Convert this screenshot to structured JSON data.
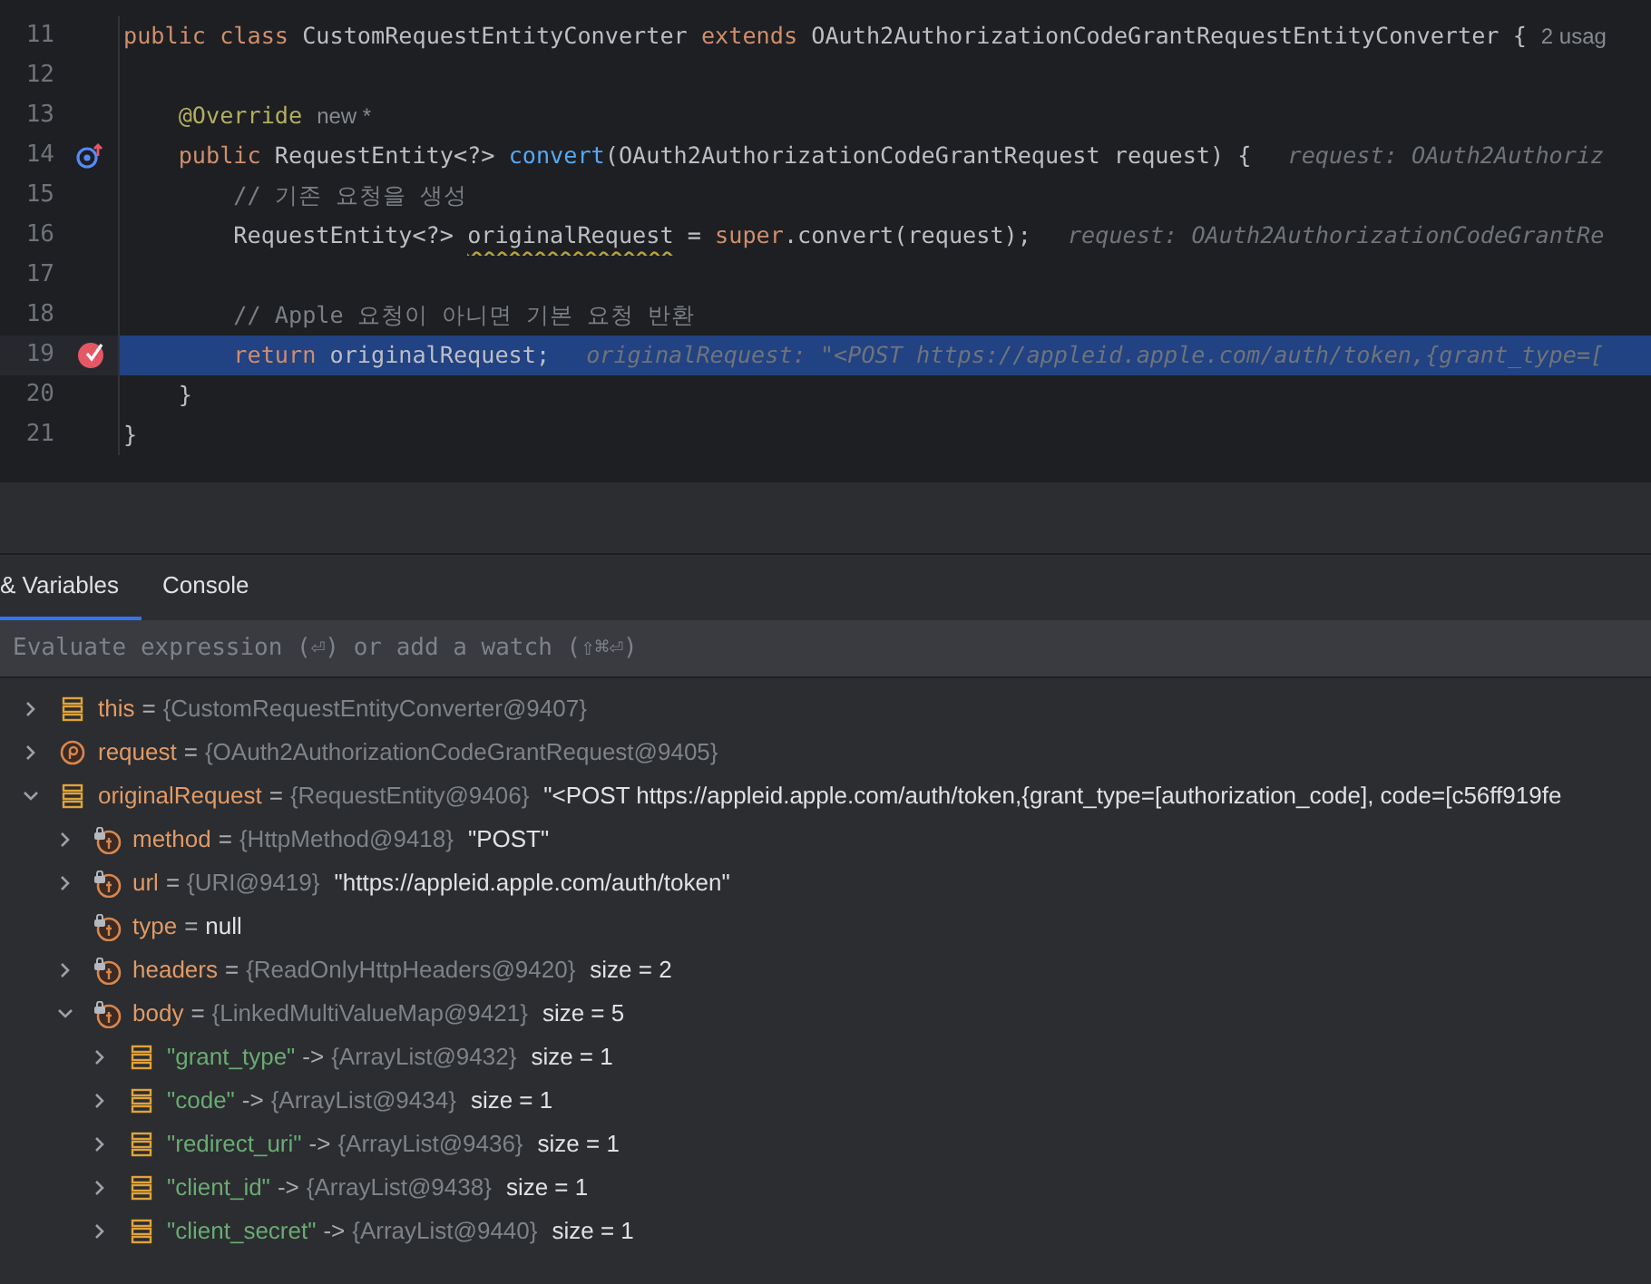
{
  "editor": {
    "lines": [
      {
        "number": "11",
        "breakpoint": false,
        "overrides": false,
        "highlighted": false,
        "tokens": [
          {
            "text": "public class ",
            "kind": "kw"
          },
          {
            "text": "CustomRequestEntityConverter ",
            "kind": "plain"
          },
          {
            "text": "extends ",
            "kind": "kw"
          },
          {
            "text": "OAuth2AuthorizationCodeGrantRequestEntityConverter {",
            "kind": "plain"
          },
          {
            "text": "2 usag",
            "kind": "meta"
          }
        ]
      },
      {
        "number": "12",
        "breakpoint": false,
        "overrides": false,
        "highlighted": false
      },
      {
        "number": "13",
        "breakpoint": false,
        "overrides": false,
        "highlighted": false,
        "tokens": [
          {
            "text": "    @Override",
            "kind": "ann"
          },
          {
            "text": "new *",
            "kind": "meta"
          }
        ]
      },
      {
        "number": "14",
        "breakpoint": false,
        "overrides": true,
        "highlighted": false,
        "tokens": [
          {
            "text": "    public ",
            "kind": "kw"
          },
          {
            "text": "RequestEntity<?> ",
            "kind": "plain"
          },
          {
            "text": "convert",
            "kind": "fn"
          },
          {
            "text": "(OAuth2AuthorizationCodeGrantRequest request) {",
            "kind": "plain"
          },
          {
            "text": "request: OAuth2Authoriz",
            "kind": "hint"
          }
        ]
      },
      {
        "number": "15",
        "breakpoint": false,
        "overrides": false,
        "highlighted": false,
        "tokens": [
          {
            "text": "        // 기존 요청을 생성",
            "kind": "cmt"
          }
        ]
      },
      {
        "number": "16",
        "breakpoint": false,
        "overrides": false,
        "highlighted": false,
        "tokens": [
          {
            "text": "        RequestEntity<?> ",
            "kind": "plain"
          },
          {
            "text": "originalRequest",
            "kind": "warn"
          },
          {
            "text": " = ",
            "kind": "plain"
          },
          {
            "text": "super",
            "kind": "kw"
          },
          {
            "text": ".convert(request);",
            "kind": "plain"
          },
          {
            "text": "request: OAuth2AuthorizationCodeGrantRe",
            "kind": "hint"
          }
        ]
      },
      {
        "number": "17",
        "breakpoint": false,
        "overrides": false,
        "highlighted": false
      },
      {
        "number": "18",
        "breakpoint": false,
        "overrides": false,
        "highlighted": false,
        "tokens": [
          {
            "text": "        // Apple 요청이 아니면 기본 요청 반환",
            "kind": "cmt"
          }
        ]
      },
      {
        "number": "19",
        "breakpoint": true,
        "overrides": false,
        "highlighted": true,
        "tokens": [
          {
            "text": "        return ",
            "kind": "kw"
          },
          {
            "text": "originalRequest;",
            "kind": "plain"
          },
          {
            "text": "originalRequest: \"<POST https://appleid.apple.com/auth/token,{grant_type=[",
            "kind": "hint"
          }
        ]
      },
      {
        "number": "20",
        "breakpoint": false,
        "overrides": false,
        "highlighted": false,
        "tokens": [
          {
            "text": "    }",
            "kind": "plain"
          }
        ]
      },
      {
        "number": "21",
        "breakpoint": false,
        "overrides": false,
        "highlighted": false,
        "tokens": [
          {
            "text": "}",
            "kind": "plain"
          }
        ]
      }
    ]
  },
  "debug_panel": {
    "tabs": [
      {
        "label": "& Variables",
        "selected": true
      },
      {
        "label": "Console",
        "selected": false
      }
    ],
    "watch_field": {
      "placeholder": "Evaluate expression (⏎) or add a watch (⇧⌘⏎)"
    },
    "variables": [
      {
        "kind": "object",
        "name": "this",
        "sep": "=",
        "type": "{CustomRequestEntityConverter@9407}",
        "expanded": false
      },
      {
        "kind": "param",
        "name": "request",
        "sep": "=",
        "type": "{OAuth2AuthorizationCodeGrantRequest@9405}",
        "expanded": false
      },
      {
        "kind": "object",
        "name": "originalRequest",
        "sep": "=",
        "type": "{RequestEntity@9406}",
        "value": "\"<POST https://appleid.apple.com/auth/token,{grant_type=[authorization_code], code=[c56ff919fe",
        "expanded": true,
        "children": [
          {
            "kind": "field",
            "name": "method",
            "sep": "=",
            "type": "{HttpMethod@9418}",
            "value": "\"POST\"",
            "expanded": false
          },
          {
            "kind": "field",
            "name": "url",
            "sep": "=",
            "type": "{URI@9419}",
            "value": "\"https://appleid.apple.com/auth/token\"",
            "expanded": false
          },
          {
            "kind": "field",
            "name": "type",
            "sep": "=",
            "value": "null"
          },
          {
            "kind": "field",
            "name": "headers",
            "sep": "=",
            "type": "{ReadOnlyHttpHeaders@9420}",
            "value": "size = 2",
            "expanded": false
          },
          {
            "kind": "field",
            "name": "body",
            "sep": "=",
            "type": "{LinkedMultiValueMap@9421}",
            "value": "size = 5",
            "expanded": true,
            "children": [
              {
                "kind": "entry",
                "name": "\"grant_type\"",
                "sep": "->",
                "type": "{ArrayList@9432}",
                "value": "size = 1",
                "expanded": false
              },
              {
                "kind": "entry",
                "name": "\"code\"",
                "sep": "->",
                "type": "{ArrayList@9434}",
                "value": "size = 1",
                "expanded": false
              },
              {
                "kind": "entry",
                "name": "\"redirect_uri\"",
                "sep": "->",
                "type": "{ArrayList@9436}",
                "value": "size = 1",
                "expanded": false
              },
              {
                "kind": "entry",
                "name": "\"client_id\"",
                "sep": "->",
                "type": "{ArrayList@9438}",
                "value": "size = 1",
                "expanded": false
              },
              {
                "kind": "entry",
                "name": "\"client_secret\"",
                "sep": "->",
                "type": "{ArrayList@9440}",
                "value": "size = 1",
                "expanded": false
              }
            ]
          }
        ]
      }
    ]
  }
}
